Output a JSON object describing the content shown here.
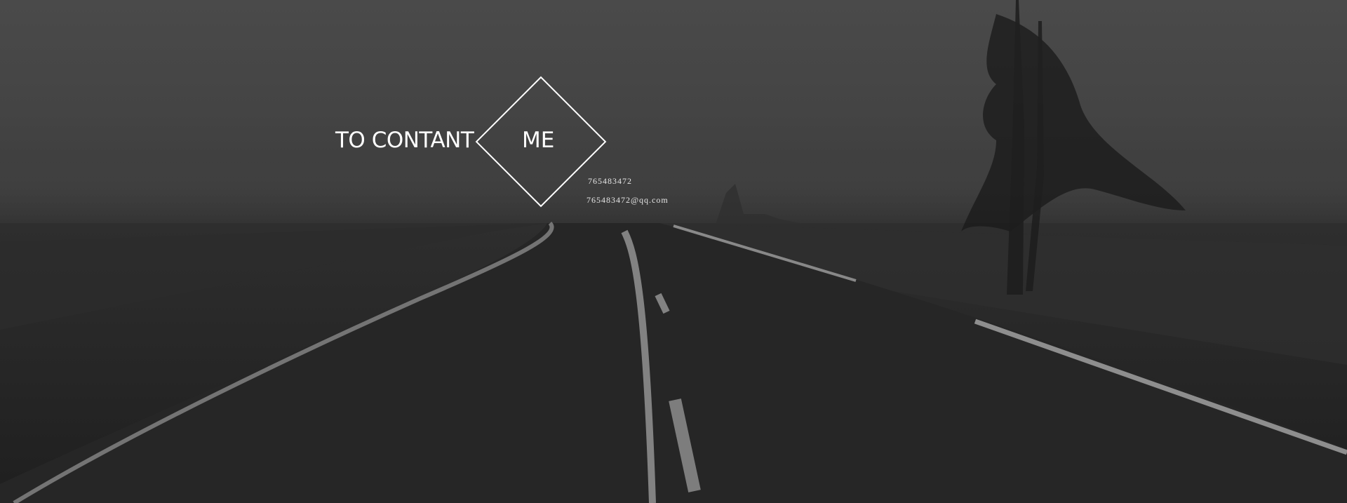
{
  "contact": {
    "heading_left": "TO CONTANT",
    "heading_right": "ME",
    "phone": "765483472",
    "email": "765483472@qq.com"
  },
  "colors": {
    "text": "#ffffff",
    "sky": "#4a4a4a",
    "ground": "#222222",
    "road_line": "#a9a9a9"
  },
  "icons": {
    "diamond": "diamond-outline-icon"
  }
}
